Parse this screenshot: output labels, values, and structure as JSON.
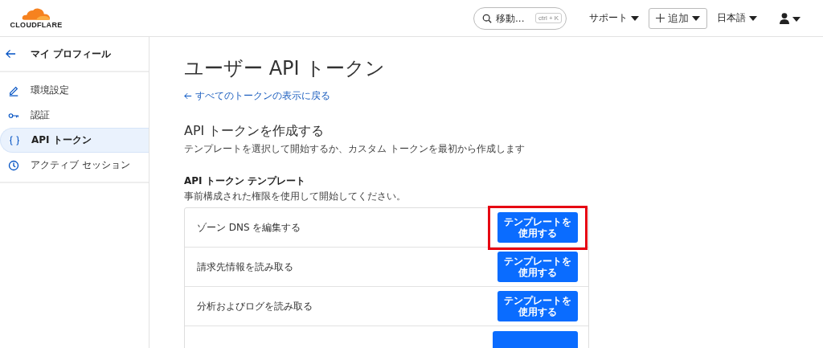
{
  "header": {
    "logo": "CLOUDFLARE",
    "search": {
      "placeholder": "移動...",
      "shortcut": "ctrl + K"
    },
    "menus": [
      {
        "label": "サポート",
        "kind": "dropdown"
      },
      {
        "label": "追加",
        "kind": "add"
      },
      {
        "label": "日本語",
        "kind": "dropdown"
      },
      {
        "kind": "user"
      }
    ]
  },
  "sidebar": {
    "back_title": "マイ プロフィール",
    "items": [
      {
        "label": "環境設定",
        "selected": false
      },
      {
        "label": "認証",
        "selected": false
      },
      {
        "label": "API トークン",
        "selected": true
      },
      {
        "label": "アクティブ セッション",
        "selected": false
      }
    ]
  },
  "main": {
    "title": "ユーザー API トークン",
    "back_link": "すべてのトークンの表示に戻る",
    "create_heading": "API トークンを作成する",
    "create_description": "テンプレートを選択して開始するか、カスタム トークンを最初から作成します",
    "templates_heading": "API トークン テンプレート",
    "templates_description": "事前構成された権限を使用して開始してください。",
    "templates": [
      {
        "name": "ゾーン DNS を編集する",
        "button": "テンプレートを使用する",
        "highlighted": true
      },
      {
        "name": "請求先情報を読み取る",
        "button": "テンプレートを使用する",
        "highlighted": false
      },
      {
        "name": "分析およびログを読み取る",
        "button": "テンプレートを使用する",
        "highlighted": false
      }
    ]
  }
}
